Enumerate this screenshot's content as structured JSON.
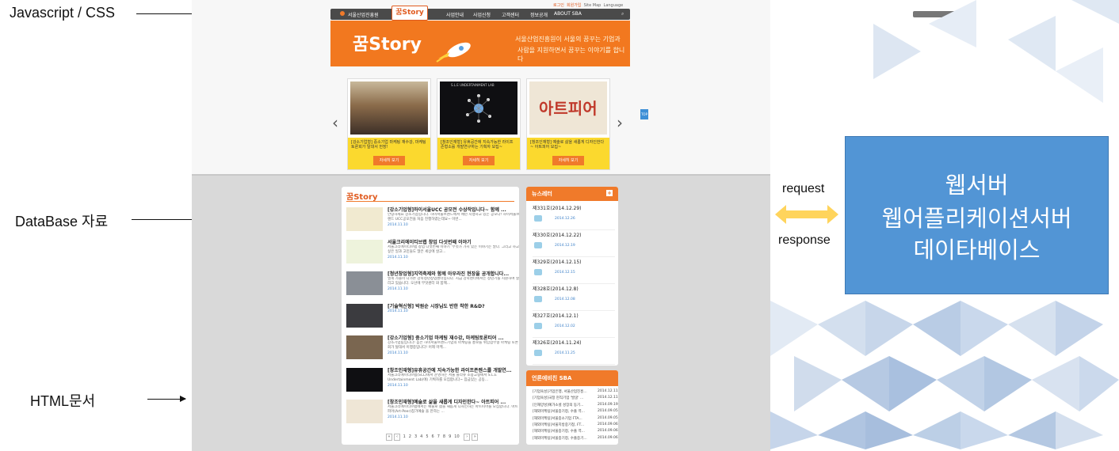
{
  "annotations": {
    "js_css": "Javascript / CSS",
    "database": "DataBase 자료",
    "html": "HTML문서",
    "request": "request",
    "response": "response"
  },
  "server_box": {
    "line1": "웹서버",
    "line2": "웹어플리케이션서버",
    "line3": "데이타베이스"
  },
  "site": {
    "util_links": [
      "로그인",
      "회원가입",
      "Site Map",
      "Language"
    ],
    "nav_brand": "서울산업진흥원",
    "nav_logo": "꿈Story",
    "nav_items": [
      "사업안내",
      "사업신청",
      "고객센터",
      "정보공개",
      "ABOUT SBA"
    ],
    "banner_logo": "꿈Story",
    "banner_text_1": "서울산업진흥원이 서울의 꿈꾸는 기업과",
    "banner_text_2": "사람을 지원하면서 꿈꾸는 이야기를 합니다",
    "carousel": [
      {
        "caption": "[강소기업형] 중소기업 마케팅 재수강, 마케팅 토론회가 탈대서 헌장!",
        "button": "자세히 보기",
        "img_label": ""
      },
      {
        "caption": "[창조인재형] 유휴공간에 지속가능한 라이프존형소를 개발연구하는 기획자 모집~",
        "button": "자세히 보기",
        "img_label": "S.L.E UNDERTAINMENT LAB"
      },
      {
        "caption": "[창조인재형] 예술로 삶을 새롭게 디자인한다~ 아트피어 모집~",
        "button": "자세히 보기",
        "img_label": "아트피어"
      }
    ],
    "story_title": "꿈Story",
    "articles": [
      {
        "title": "[강소기업형]하이서울UCC 공모전 수상작입니다~ 함께 ...",
        "desc": "안녕하세요 강소기업입니다. 하이서울브랜드에서 매년 시행하고 있는 공모다! 하이서울브랜드 UCC공모전을 처음 진행하였는데요~ 이번...",
        "date": "2014.11.10"
      },
      {
        "title": "서울크리에이티브랩 창업 다섯번째 이야기",
        "desc": "서울크리에이티브랩 창업 다섯번째 이야기 '무엇가 가치 있는 이야기는 말다. 그리고 하고 싶은 일과 고민들도 많은 세상에 살고...",
        "date": "2014.11.10"
      },
      {
        "title": "[청년창업형]지역축제와 함께 아우라진 현장을 공개합니다...",
        "desc": "멀게 가을이 다가온 강북청년창업센터입니다. 지금 강북센터에서는 청년기를 지원하며 열리고 있습니다. 오산에 무엇센터 와 함께...",
        "date": "2014.11.10"
      },
      {
        "title": "[기술혁신형] 박원순 시장님도 반한 착한 R&D?",
        "desc": "",
        "date": "2014.11.10"
      },
      {
        "title": "[강소기업형] 중소기업 마케팅 재수강, 마케팅토론티어 ...",
        "desc": "강소기업팀입니다! 높은 하이서울브랜드기업의 마케팅을 홍보를 위임업무형 마케팅 토론회가 탈대서 이행중입니다! 어제 마케...",
        "date": "2014.11.10"
      },
      {
        "title": "[창조인재형]유휴공간에 지속가능한 라이프존렌스를 개발연...",
        "desc": "서울크리에이티브랩(SCL)에서 운영하는 서울 플라쥬 조용고형에서 S.L.E Undertainment Lab(에) 기획자를 모집합니다~ 잠금있는 공동...",
        "date": "2014.11.10"
      },
      {
        "title": "[창조인재형]예술로 삶을 새롭게 디자인한다~ 아트피어 ...",
        "desc": "서울크리에이티브랩에서는 예술로 삶을 새롭게 디자인하는 아트피어를 모집합니다. 아트피어(Art-Peer)참가예술 을 만하는 ...",
        "date": "2014.11.10"
      }
    ],
    "pager": [
      "«",
      "‹",
      "1",
      "2",
      "3",
      "4",
      "5",
      "6",
      "7",
      "8",
      "9",
      "10",
      "›",
      "»"
    ],
    "newsletter_title": "뉴스레터",
    "newsletters": [
      {
        "title": "제331호(2014.12.29)",
        "date": "2014.12.26"
      },
      {
        "title": "제330호(2014.12.22)",
        "date": "2014.12.19"
      },
      {
        "title": "제329호(2014.12.15)",
        "date": "2014.12.15"
      },
      {
        "title": "제328호(2014.12.8)",
        "date": "2014.12.08"
      },
      {
        "title": "제327호(2014.12.1)",
        "date": "2014.12.02"
      },
      {
        "title": "제326호(2014.11.24)",
        "date": "2014.11.25"
      }
    ],
    "press_title": "언론에비친 SBA",
    "press": [
      {
        "text": "[기업육성]기업은행, 서울산업진흥...",
        "date": "2014.12.11"
      },
      {
        "text": "[기업육성]국정 현직기업 '발굴' ...",
        "date": "2014.12.11"
      },
      {
        "text": "[인재양성]예가소셜 성장의 동기...",
        "date": "2014.09.19"
      },
      {
        "text": "[해외마케팅]서울중기청, 수출 역...",
        "date": "2014.09.05"
      },
      {
        "text": "[해외마케팅]서울중소기업 FTA...",
        "date": "2014.09.05"
      },
      {
        "text": "[해외마케팅]서울지방중기청, FT...",
        "date": "2014.09.06"
      },
      {
        "text": "[해외마케팅]서울중기청, 수출 역...",
        "date": "2014.09.06"
      },
      {
        "text": "[해외마케팅]서울중기청, 수출중기...",
        "date": "2014.09.06"
      }
    ]
  }
}
